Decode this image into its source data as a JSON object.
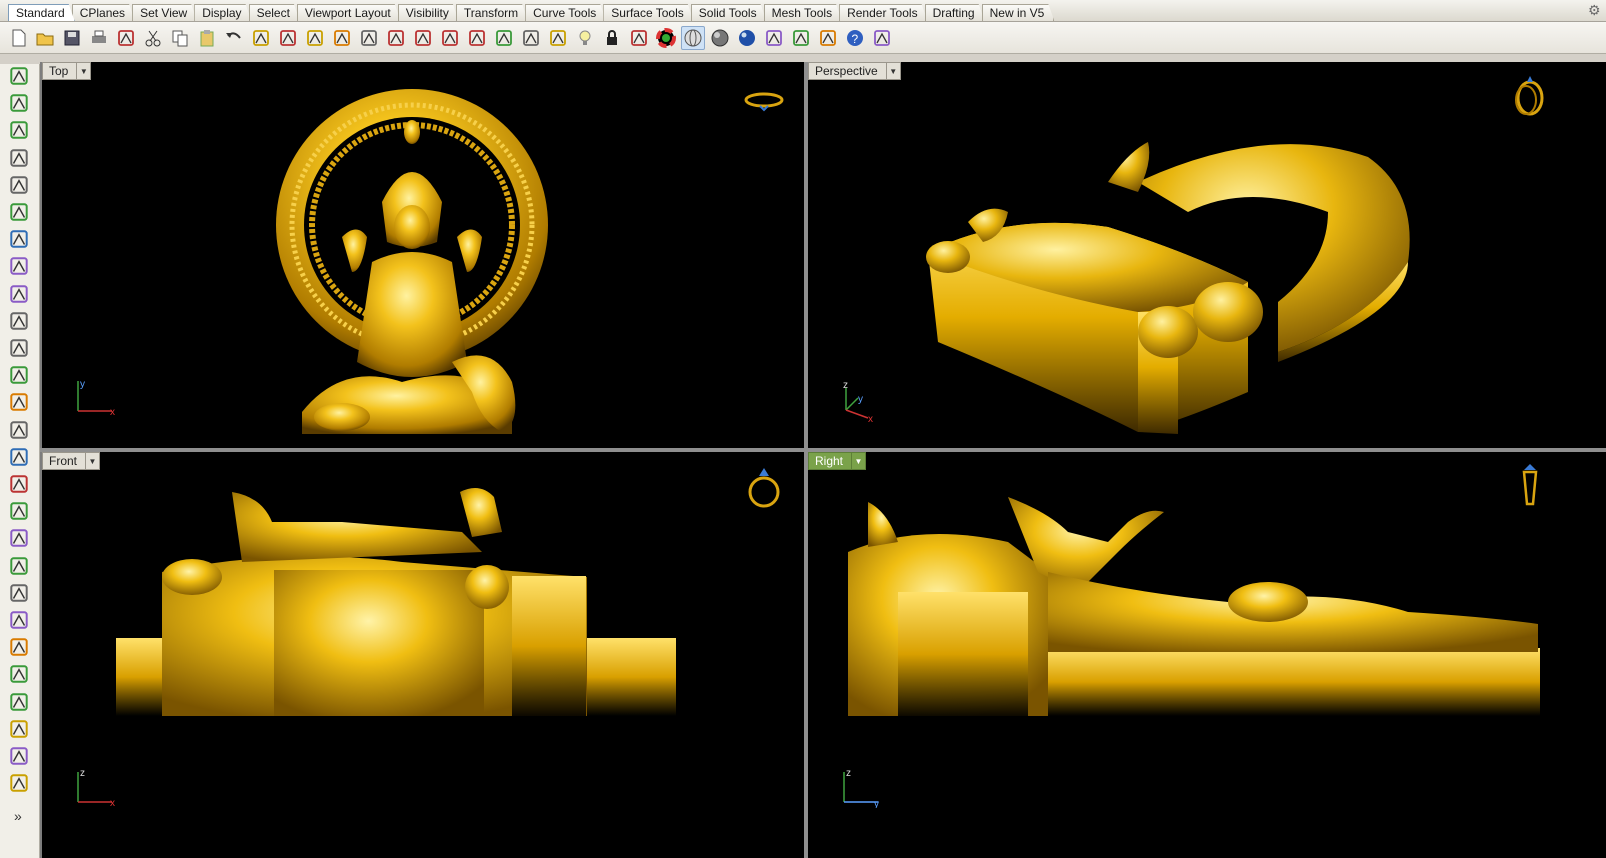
{
  "tabs": [
    "Standard",
    "CPlanes",
    "Set View",
    "Display",
    "Select",
    "Viewport Layout",
    "Visibility",
    "Transform",
    "Curve Tools",
    "Surface Tools",
    "Solid Tools",
    "Mesh Tools",
    "Render Tools",
    "Drafting",
    "New in V5"
  ],
  "active_tab": "Standard",
  "toolbar_icons": [
    "new-icon",
    "open-icon",
    "save-icon",
    "print-icon",
    "import-icon",
    "cut-icon",
    "copy-icon",
    "paste-icon",
    "undo-icon",
    "pan-hand-icon",
    "rotate-view-icon",
    "zoom-icon",
    "zoom-window-icon",
    "zoom-extents-icon",
    "zoom-selected-icon",
    "undo-view-icon",
    "four-viewports-icon",
    "car-icon",
    "eye-icon",
    "target-icon",
    "align-icon",
    "lightbulb-icon",
    "lock-icon",
    "layer-icon",
    "color-wheel-icon",
    "wireframe-sphere-icon",
    "shaded-sphere-icon",
    "render-sphere-icon",
    "flag-icon",
    "options-gear-icon",
    "dimension-icon",
    "help-icon",
    "funnel-icon"
  ],
  "viewports": {
    "top": {
      "title": "Top",
      "axis_h": "x",
      "axis_v": "y"
    },
    "perspective": {
      "title": "Perspective",
      "axis_a": "z",
      "axis_b": "y",
      "axis_c": "x"
    },
    "front": {
      "title": "Front",
      "axis_h": "x",
      "axis_v": "z"
    },
    "right": {
      "title": "Right",
      "axis_h": "y",
      "axis_v": "z"
    }
  },
  "left_toolbar_icons": [
    "select-arrow-icon",
    "point-icon",
    "polyline-icon",
    "curve-icon",
    "circle-icon",
    "ellipse-icon",
    "polygon-icon",
    "rectangle-icon",
    "hexagon-icon",
    "fillet-icon",
    "surface-icon",
    "surface-edit-icon",
    "box-icon",
    "sphere-icon",
    "extrude-icon",
    "mesh-icon",
    "boolean-icon",
    "explode-icon",
    "transform-icon",
    "trim-icon",
    "group-icon",
    "point-cloud-icon",
    "curve-edit-icon",
    "rebuild-icon",
    "text-icon",
    "array-icon",
    "block-icon"
  ],
  "more_label": "»",
  "colors": {
    "gold": "#e1a800",
    "gold_light": "#ffd84a",
    "gold_dark": "#8a6000",
    "active_vp": "#7aa24a"
  }
}
